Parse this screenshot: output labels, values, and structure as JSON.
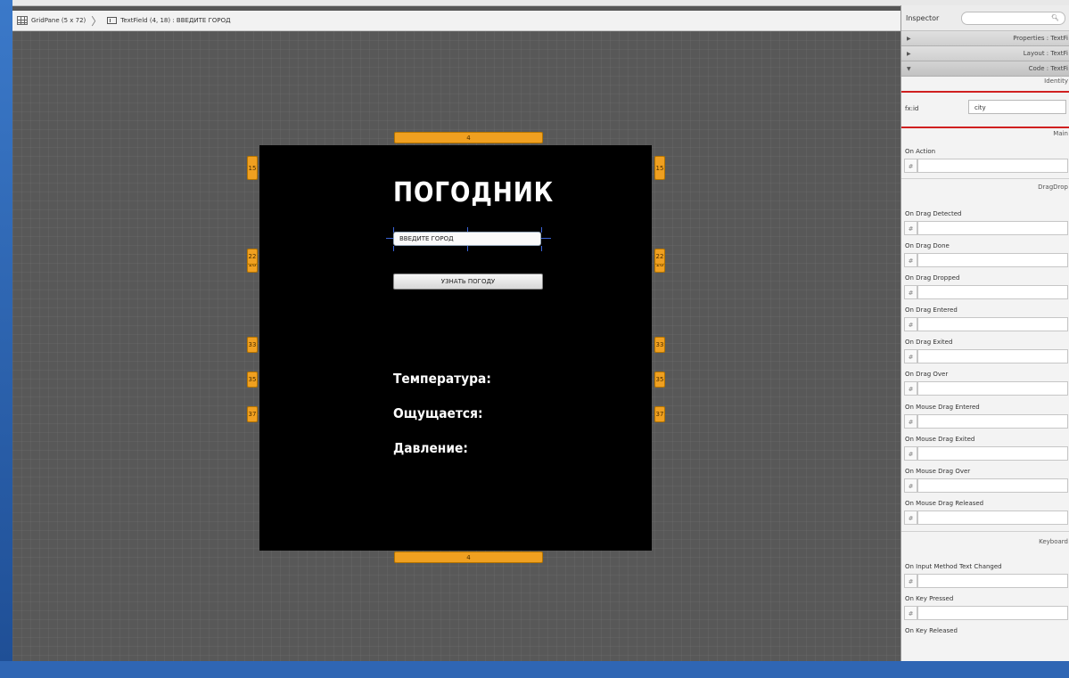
{
  "breadcrumb": {
    "grid_label": "GridPane (5 x 72)",
    "textfield_label": "TextField (4, 18) : ВВЕДИТЕ ГОРОД"
  },
  "stage": {
    "title": "ПОГОДНИК",
    "city_field_value": "ВВЕДИТЕ ГОРОД",
    "button_label": "УЗНАТЬ ПОГОДУ",
    "temperature_label": "Температура:",
    "feels_like_label": "Ощущается:",
    "pressure_label": "Давление:",
    "column_marker_top": "4",
    "column_marker_bottom": "4",
    "row_markers": [
      "15",
      "18",
      "22",
      "33",
      "35",
      "37"
    ]
  },
  "inspector": {
    "title": "Inspector",
    "sections": [
      "Properties : TextFi",
      "Layout : TextFi",
      "Code : TextFi"
    ],
    "identity_header": "Identity",
    "fxid_label": "fx:id",
    "fxid_value": "city",
    "main_header": "Main",
    "on_action_label": "On Action",
    "dragdrop_header": "DragDrop",
    "drag_fields": [
      "On Drag Detected",
      "On Drag Done",
      "On Drag Dropped",
      "On Drag Entered",
      "On Drag Exited",
      "On Drag Over",
      "On Mouse Drag Entered",
      "On Mouse Drag Exited",
      "On Mouse Drag Over",
      "On Mouse Drag Released"
    ],
    "keyboard_header": "Keyboard",
    "keyboard_fields": [
      "On Input Method Text Changed",
      "On Key Pressed",
      "On Key Released"
    ],
    "hash_symbol": "#"
  },
  "colors": {
    "accent_orange": "#f0a020",
    "selection_red": "#d02020",
    "stage_black": "#000000"
  }
}
